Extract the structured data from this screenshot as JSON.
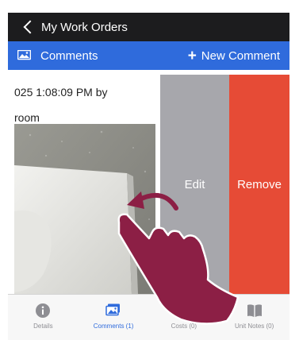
{
  "nav": {
    "title": "My Work Orders"
  },
  "section": {
    "title": "Comments",
    "new_comment_label": "New Comment",
    "plus_glyph": "+"
  },
  "comment": {
    "meta_text": "025 1:08:09 PM by",
    "body_text": "room"
  },
  "swipe": {
    "edit_label": "Edit",
    "remove_label": "Remove"
  },
  "tabs": [
    {
      "label": "Details",
      "icon": "info-icon"
    },
    {
      "label": "Comments (1)",
      "icon": "comments-icon",
      "active": true
    },
    {
      "label": "Costs (0)",
      "icon": "cost-document-icon"
    },
    {
      "label": "Unit Notes (0)",
      "icon": "book-icon"
    }
  ],
  "colors": {
    "nav_bg": "#1c1c1e",
    "accent": "#2f6bdc",
    "edit_bg": "#a7a7ac",
    "remove_bg": "#e64b36",
    "gesture_hand": "#8c1f45"
  }
}
